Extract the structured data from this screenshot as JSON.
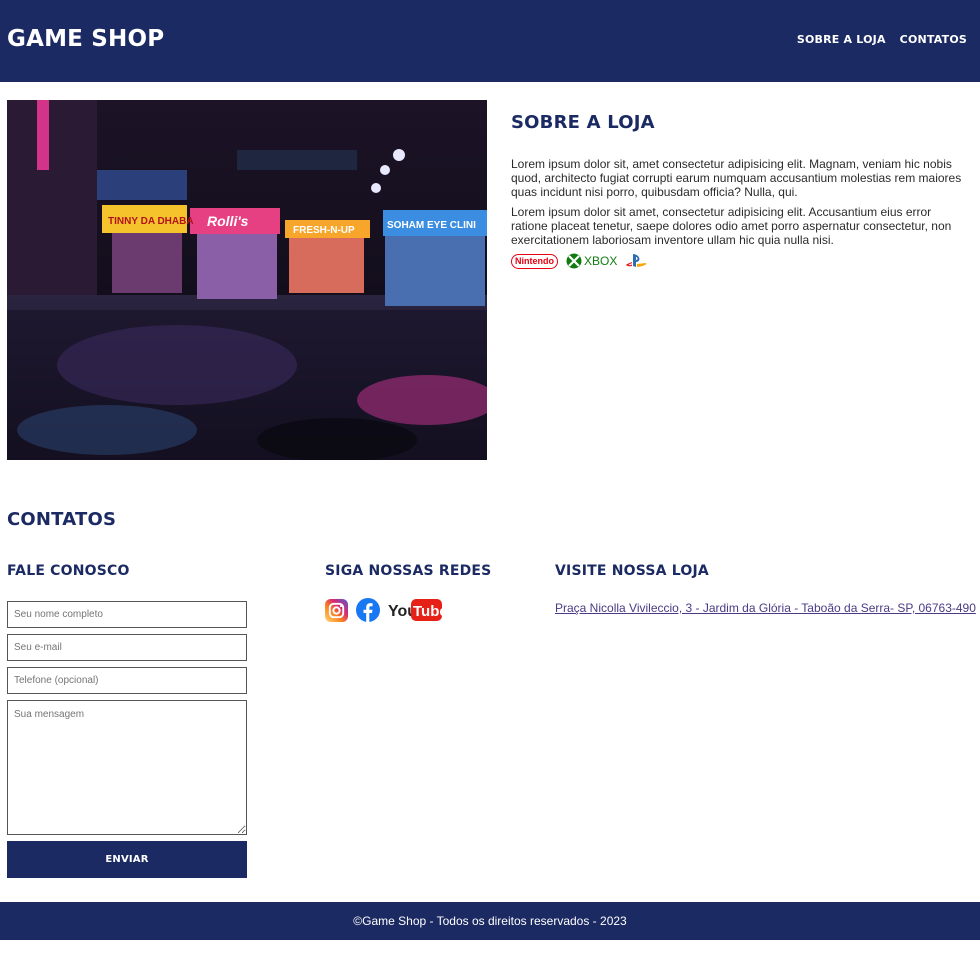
{
  "header": {
    "brand": "GAME SHOP",
    "nav": [
      "SOBRE A LOJA",
      "CONTATOS"
    ]
  },
  "about": {
    "title": "SOBRE A LOJA",
    "paragraphs": [
      "Lorem ipsum dolor sit, amet consectetur adipisicing elit. Magnam, veniam hic nobis quod, architecto fugiat corrupti earum numquam accusantium molestias rem maiores quas incidunt nisi porro, quibusdam officia? Nulla, qui.",
      "Lorem ipsum dolor sit amet, consectetur adipisicing elit. Accusantium eius error ratione placeat tenetur, saepe dolores odio amet porro aspernatur consectetur, non exercitationem laboriosam inventore ullam hic quia nulla nisi."
    ],
    "brands": [
      "Nintendo",
      "XBOX",
      "playstation-icon"
    ]
  },
  "hero_image": {
    "signs": [
      "TINNY DA DHABA",
      "Rolli's",
      "FRESH-N-UP",
      "SOHAM EYE CLINI"
    ]
  },
  "contacts": {
    "title": "CONTATOS",
    "form": {
      "title": "FALE CONOSCO",
      "name_placeholder": "Seu nome completo",
      "email_placeholder": "Seu e-mail",
      "phone_placeholder": "Telefone (opcional)",
      "message_placeholder": "Sua mensagem",
      "submit_label": "ENVIAR"
    },
    "social": {
      "title": "SIGA NOSSAS REDES",
      "icons": [
        "instagram-icon",
        "facebook-icon",
        "youtube-icon"
      ],
      "youtube_you": "You",
      "youtube_tube": "Tube"
    },
    "visit": {
      "title": "VISITE NOSSA LOJA",
      "address": "Praça Nicolla Vivileccio, 3 - Jardim da Glória - Taboão da Serra- SP, 06763-490"
    }
  },
  "footer": {
    "text": "©Game Shop - Todos os direitos reservados - 2023"
  },
  "colors": {
    "brand": "#1b2a63",
    "link": "#4b3a86",
    "nintendo": "#e60012",
    "xbox": "#107c10"
  }
}
